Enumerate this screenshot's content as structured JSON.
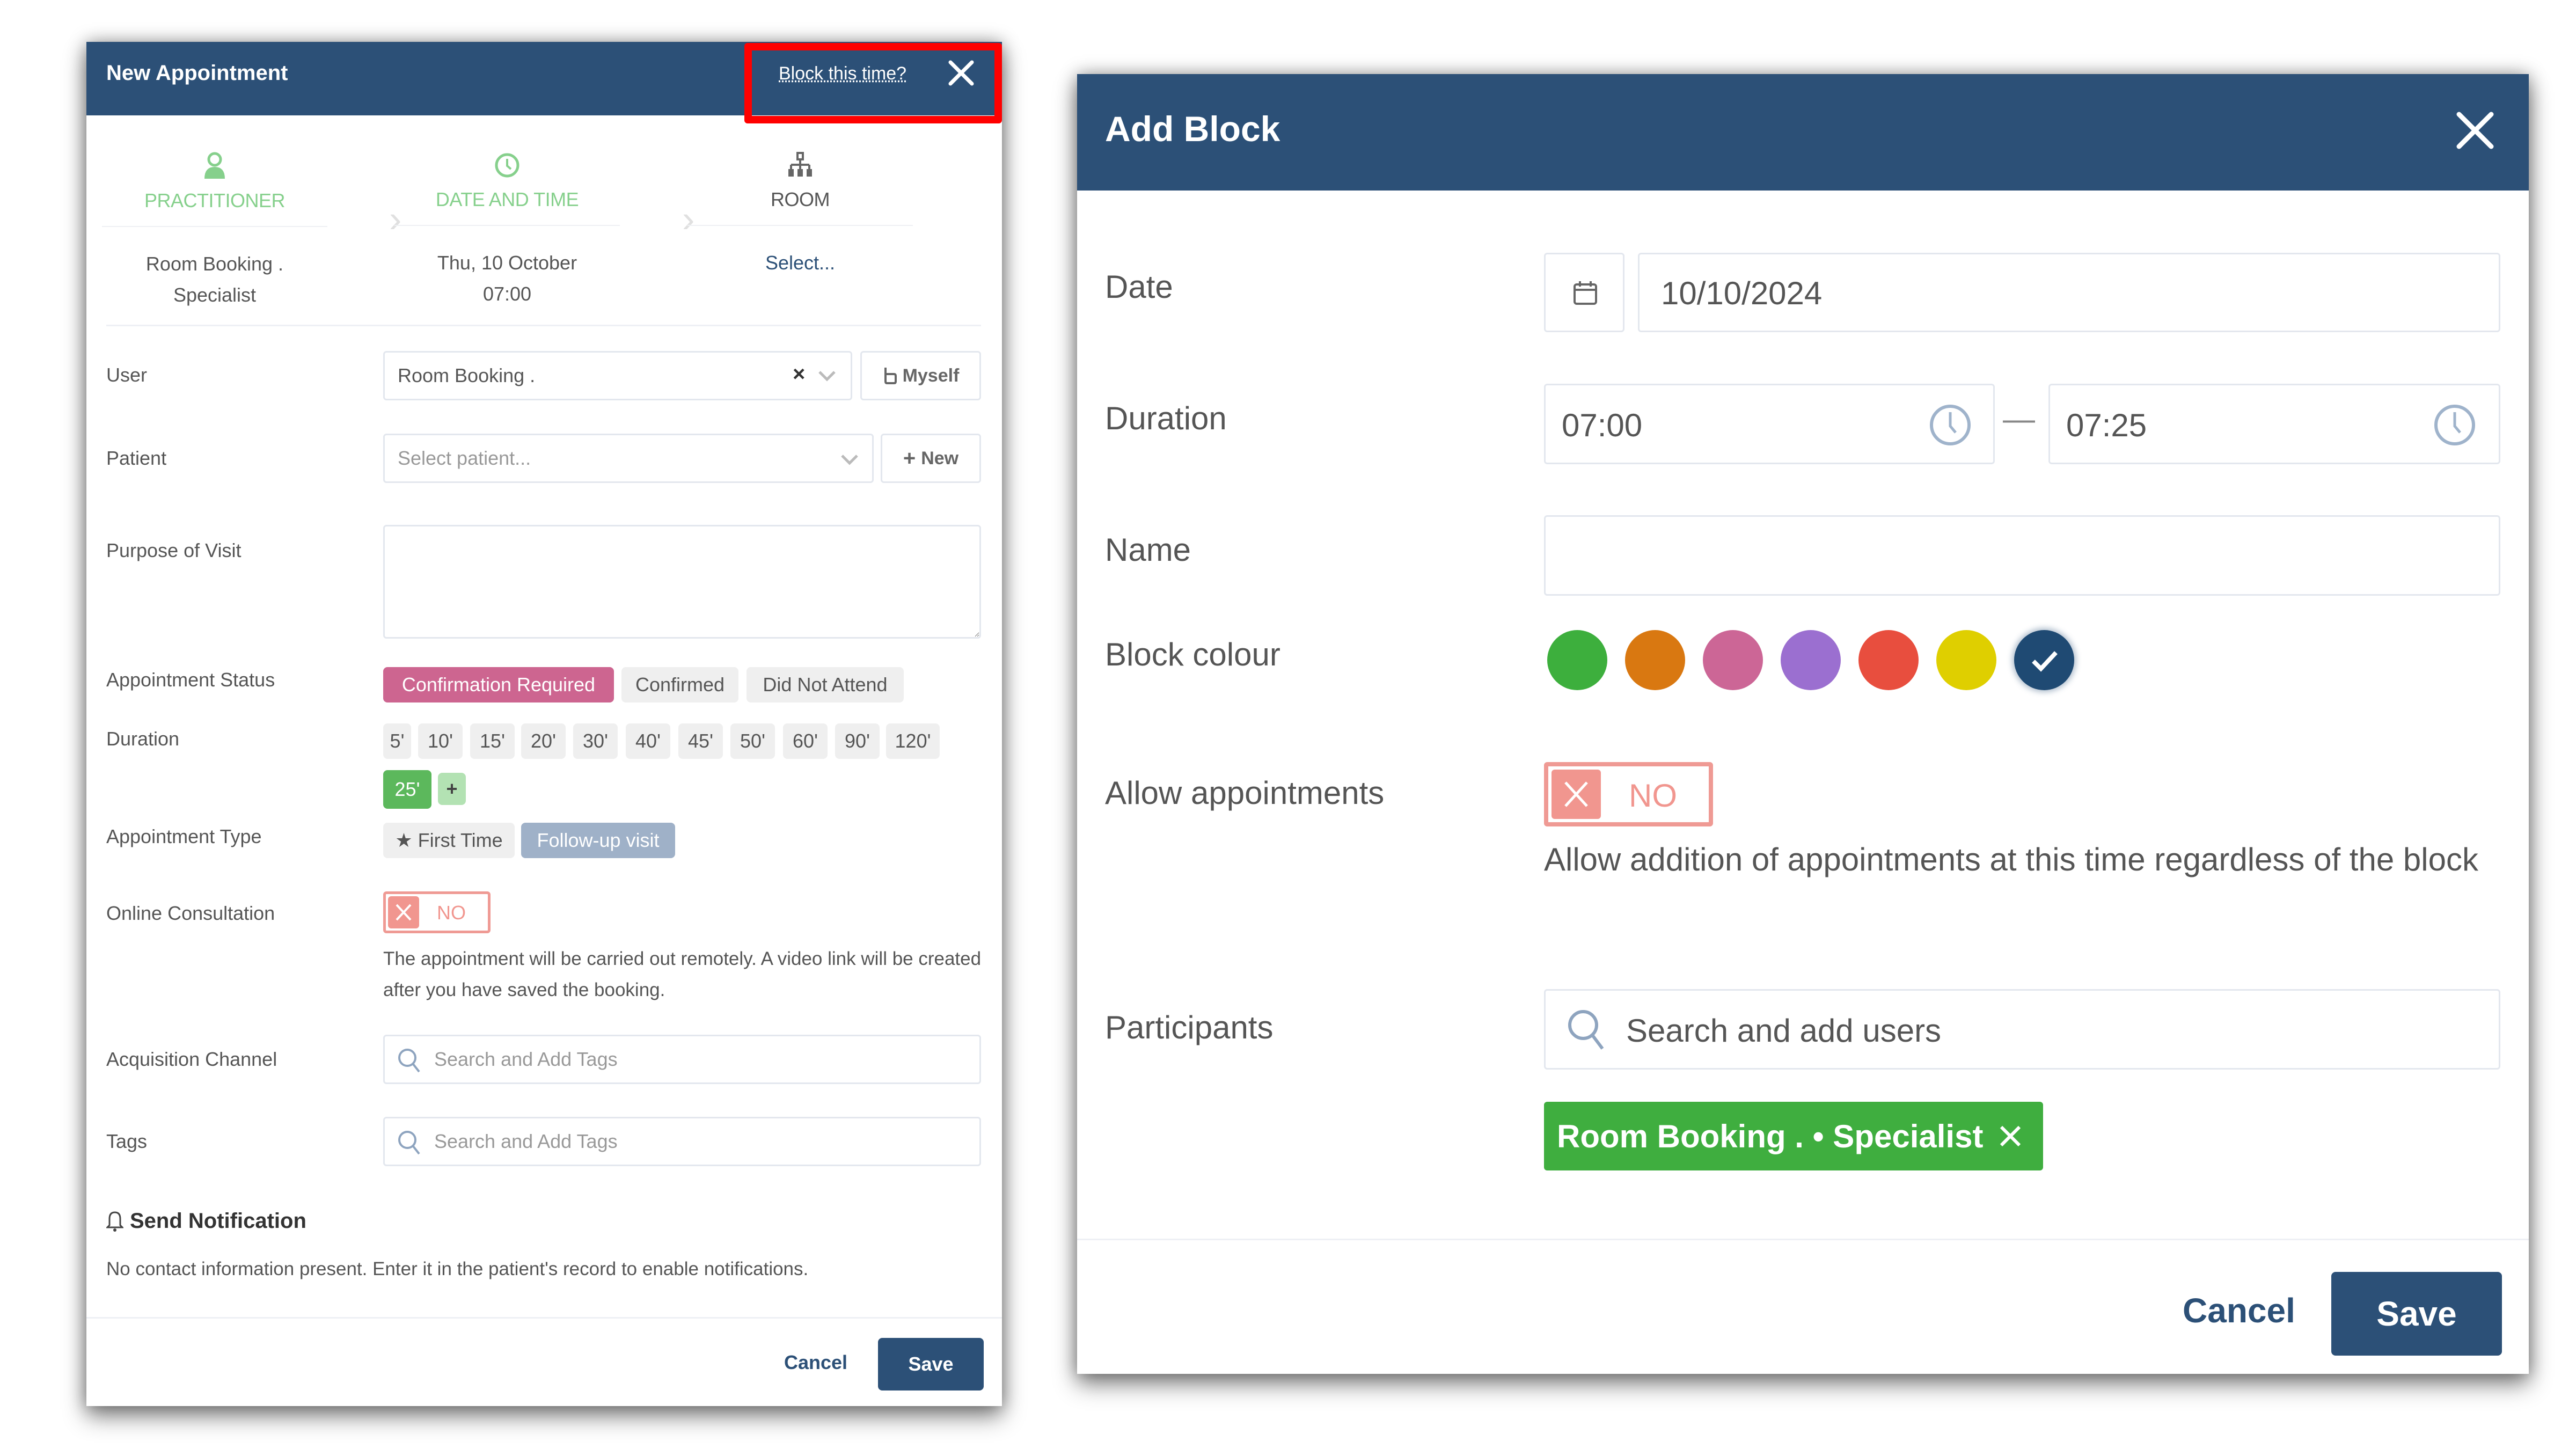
{
  "appointment_modal": {
    "title": "New Appointment",
    "block_link": "Block this time?",
    "close_icon": "close-icon",
    "steps": [
      {
        "icon": "user-icon",
        "label": "PRACTITIONER",
        "value_line1": "Room Booking .",
        "value_line2": "Specialist",
        "state": "done"
      },
      {
        "icon": "clock-icon",
        "label": "DATE AND TIME",
        "value_line1": "Thu, 10 October",
        "value_line2": "07:00",
        "state": "done"
      },
      {
        "icon": "sitemap-icon",
        "label": "ROOM",
        "value_line1": "Select...",
        "value_line2": "",
        "state": "pending"
      }
    ],
    "user": {
      "label": "User",
      "value": "Room Booking .",
      "clear": "×",
      "myself_button": "Myself"
    },
    "patient": {
      "label": "Patient",
      "placeholder": "Select patient...",
      "new_button": "New"
    },
    "purpose": {
      "label": "Purpose of Visit",
      "value": ""
    },
    "status": {
      "label": "Appointment Status",
      "options": [
        "Confirmation Required",
        "Confirmed",
        "Did Not Attend"
      ],
      "selected": "Confirmation Required"
    },
    "duration": {
      "label": "Duration",
      "options": [
        "5'",
        "10'",
        "15'",
        "20'",
        "30'",
        "40'",
        "45'",
        "50'",
        "60'",
        "90'",
        "120'"
      ],
      "custom": "25'",
      "add": "+",
      "selected": "25'"
    },
    "type": {
      "label": "Appointment Type",
      "options": [
        "★ First Time",
        "Follow-up visit"
      ],
      "selected": "Follow-up visit"
    },
    "online": {
      "label": "Online Consultation",
      "toggle": "NO",
      "help": "The appointment will be carried out remotely. A video link will be created after you have saved the booking."
    },
    "acquisition": {
      "label": "Acquisition Channel",
      "placeholder": "Search and Add Tags"
    },
    "tags": {
      "label": "Tags",
      "placeholder": "Search and Add Tags"
    },
    "notification": {
      "title": "Send Notification",
      "text": "No contact information present. Enter it in the patient's record to enable notifications."
    },
    "footer": {
      "cancel": "Cancel",
      "save": "Save"
    }
  },
  "block_modal": {
    "title": "Add Block",
    "date": {
      "label": "Date",
      "value": "10/10/2024"
    },
    "duration": {
      "label": "Duration",
      "start": "07:00",
      "end": "07:25",
      "separator": "—"
    },
    "name": {
      "label": "Name",
      "value": ""
    },
    "colour": {
      "label": "Block colour",
      "options": [
        "#3daf3d",
        "#d97811",
        "#cc6696",
        "#9b6fd0",
        "#e84e3e",
        "#dfcf00",
        "#1f4a73"
      ],
      "selected_index": 6
    },
    "allow": {
      "label": "Allow appointments",
      "toggle": "NO",
      "help": "Allow addition of appointments at this time regardless of the block"
    },
    "participants": {
      "label": "Participants",
      "placeholder": "Search and add users",
      "chips": [
        "Room Booking . • Specialist"
      ]
    },
    "footer": {
      "cancel": "Cancel",
      "save": "Save"
    }
  },
  "colors": {
    "header": "#2c5077",
    "highlight": "#ff0000",
    "active_step": "#86d08c",
    "status_selected": "#cd6590",
    "duration_selected": "#5cb85c",
    "toggle_off": "#f1968f",
    "chip": "#3fae3f"
  }
}
